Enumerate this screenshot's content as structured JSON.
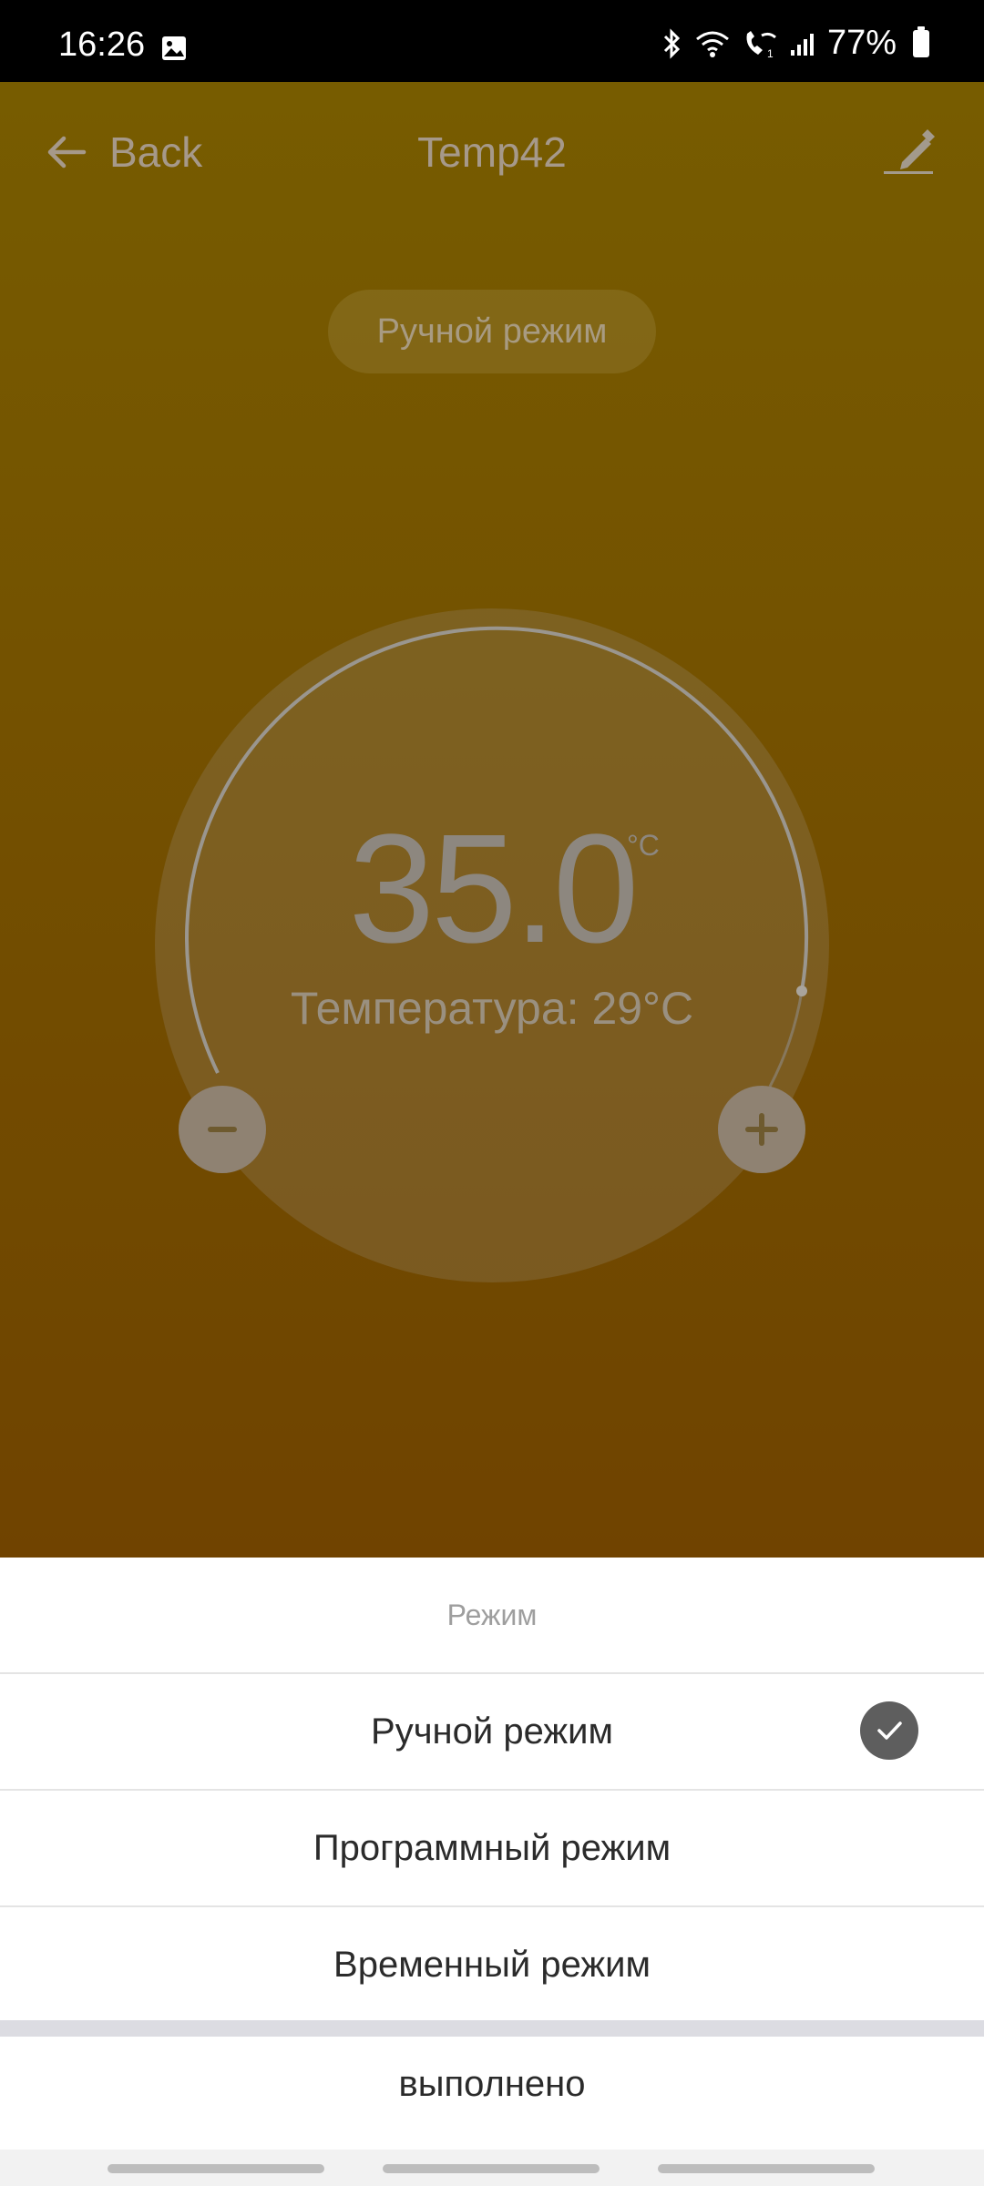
{
  "status_bar": {
    "time": "16:26",
    "battery": "77%",
    "icons": [
      "gallery-icon",
      "bluetooth-icon",
      "wifi-icon",
      "wifi-call-icon",
      "signal-icon",
      "battery-icon"
    ]
  },
  "header": {
    "back_label": "Back",
    "title": "Temp42",
    "edit_icon": "edit-pencil-icon"
  },
  "mode_pill": "Ручной режим",
  "dial": {
    "setpoint": "35.0",
    "unit": "°C",
    "current_temp": "Температура: 29°C"
  },
  "sheet": {
    "title": "Режим",
    "options": [
      {
        "label": "Ручной режим",
        "selected": true
      },
      {
        "label": "Программный режим",
        "selected": false
      },
      {
        "label": "Временный режим",
        "selected": false
      }
    ],
    "done_label": "выполнено"
  },
  "colors": {
    "app_bg_top": "#7e6100",
    "app_bg_bottom": "#764700",
    "sheet_bg": "#ffffff",
    "check_bg": "#5e5e5e"
  }
}
